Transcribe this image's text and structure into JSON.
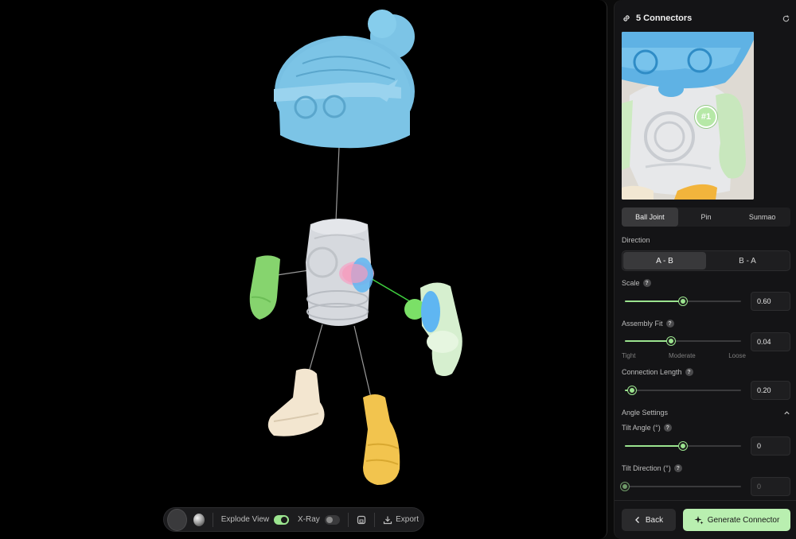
{
  "viewport": {
    "toolbar": {
      "explode_label": "Explode View",
      "explode_on": true,
      "xray_label": "X-Ray",
      "xray_on": false,
      "export_label": "Export"
    }
  },
  "panel": {
    "title": "5 Connectors",
    "preview": {
      "badge": "#1"
    },
    "joint_types": [
      {
        "label": "Ball Joint",
        "active": true
      },
      {
        "label": "Pin",
        "active": false
      },
      {
        "label": "Sunmao",
        "active": false
      }
    ],
    "direction": {
      "label": "Direction",
      "options": [
        {
          "label": "A - B",
          "active": true
        },
        {
          "label": "B - A",
          "active": false
        }
      ]
    },
    "scale": {
      "label": "Scale",
      "value": "0.60",
      "level": 0.5
    },
    "assembly_fit": {
      "label": "Assembly Fit",
      "value": "0.04",
      "level": 0.4,
      "ticks": [
        "Tight",
        "Moderate",
        "Loose"
      ]
    },
    "connection_length": {
      "label": "Connection Length",
      "value": "0.20",
      "level": 0.06
    },
    "angle_settings": {
      "label": "Angle Settings",
      "tilt_angle": {
        "label": "Tilt Angle (°)",
        "value": "0",
        "level": 0.5
      },
      "tilt_direction": {
        "label": "Tilt Direction (°)",
        "value": "0",
        "level": 0.0
      }
    },
    "back_label": "Back",
    "generate_label": "Generate Connector"
  },
  "colors": {
    "accent": "#9be48f",
    "head": "#7cc4e6",
    "body": "#d6d9de",
    "arm_left": "#86d46e",
    "arm_right": "#d6efcf",
    "foot_left": "#f3e6d0",
    "foot_right": "#f2c44e"
  }
}
